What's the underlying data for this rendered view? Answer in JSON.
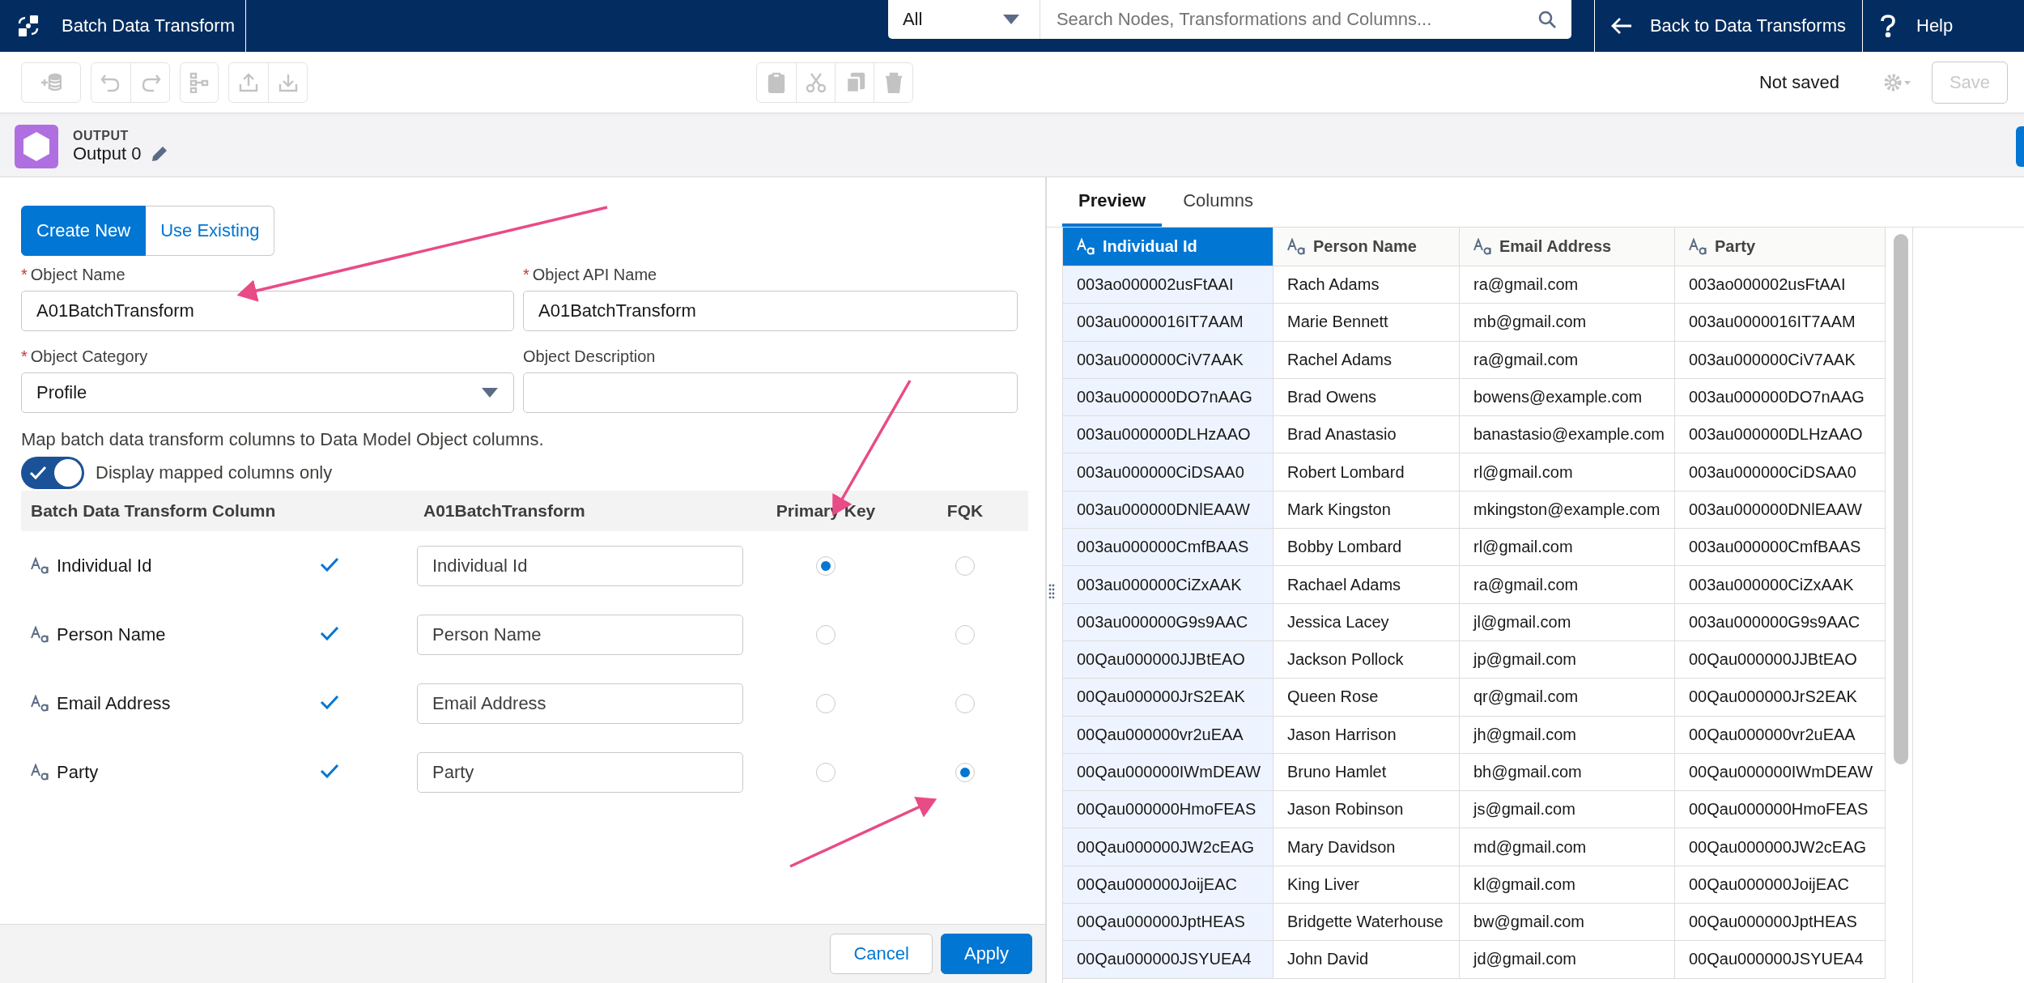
{
  "app_bar": {
    "title": "Batch Data Transform",
    "search_scope": "All",
    "search": {
      "placeholder": "Search Nodes, Transformations and Columns..."
    },
    "back_button": "Back to Data Transforms",
    "help_button": "Help"
  },
  "toolbar": {
    "status": "Not saved",
    "save_button": "Save"
  },
  "node": {
    "type_label": "OUTPUT",
    "name": "Output 0"
  },
  "form": {
    "mode_tabs": [
      {
        "label": "Create New",
        "selected": true
      },
      {
        "label": "Use Existing",
        "selected": false
      }
    ],
    "fields": [
      {
        "label": "Object Name",
        "required_mark": "*",
        "value": "A01BatchTransform",
        "kind": "text"
      },
      {
        "label": "Object API Name",
        "required_mark": "*",
        "value": "A01BatchTransform",
        "kind": "text"
      },
      {
        "label": "Object Category",
        "required_mark": "*",
        "value": "Profile",
        "kind": "select"
      },
      {
        "label": "Object Description",
        "kind": "text"
      }
    ],
    "map_hint": "Map batch data transform columns to Data Model Object columns.",
    "toggle": {
      "label": "Display mapped columns only",
      "on": true
    },
    "mapping_table": {
      "columns": [
        "Batch Data Transform Column",
        "A01BatchTransform",
        "Primary Key",
        "FQK"
      ],
      "rows": [
        {
          "source": "Individual Id",
          "mapped": true,
          "target": "Individual Id",
          "primary_key": true,
          "fqk": false
        },
        {
          "source": "Person Name",
          "mapped": true,
          "target": "Person Name",
          "primary_key": false,
          "fqk": false
        },
        {
          "source": "Email Address",
          "mapped": true,
          "target": "Email Address",
          "primary_key": false,
          "fqk": false
        },
        {
          "source": "Party",
          "mapped": true,
          "target": "Party",
          "primary_key": false,
          "fqk": true
        }
      ]
    },
    "buttons": {
      "cancel": "Cancel",
      "apply": "Apply"
    }
  },
  "preview": {
    "tabs": [
      {
        "label": "Preview",
        "selected": true
      },
      {
        "label": "Columns",
        "selected": false
      }
    ],
    "table": {
      "columns": [
        {
          "label": "Individual Id",
          "selected": true
        },
        {
          "label": "Person Name",
          "selected": false
        },
        {
          "label": "Email Address",
          "selected": false
        },
        {
          "label": "Party",
          "selected": false
        }
      ],
      "rows": [
        [
          "003ao000002usFtAAI",
          "Rach Adams",
          "ra@gmail.com",
          "003ao000002usFtAAI"
        ],
        [
          "003au0000016IT7AAM",
          "Marie Bennett",
          "mb@gmail.com",
          "003au0000016IT7AAM"
        ],
        [
          "003au000000CiV7AAK",
          "Rachel Adams",
          "ra@gmail.com",
          "003au000000CiV7AAK"
        ],
        [
          "003au000000DO7nAAG",
          "Brad Owens",
          "bowens@example.com",
          "003au000000DO7nAAG"
        ],
        [
          "003au000000DLHzAAO",
          "Brad Anastasio",
          "banastasio@example.com",
          "003au000000DLHzAAO"
        ],
        [
          "003au000000CiDSAA0",
          "Robert Lombard",
          "rl@gmail.com",
          "003au000000CiDSAA0"
        ],
        [
          "003au000000DNlEAAW",
          "Mark Kingston",
          "mkingston@example.com",
          "003au000000DNlEAAW"
        ],
        [
          "003au000000CmfBAAS",
          "Bobby Lombard",
          "rl@gmail.com",
          "003au000000CmfBAAS"
        ],
        [
          "003au000000CiZxAAK",
          "Rachael Adams",
          "ra@gmail.com",
          "003au000000CiZxAAK"
        ],
        [
          "003au000000G9s9AAC",
          "Jessica Lacey",
          "jl@gmail.com",
          "003au000000G9s9AAC"
        ],
        [
          "00Qau000000JJBtEAO",
          "Jackson Pollock",
          "jp@gmail.com",
          "00Qau000000JJBtEAO"
        ],
        [
          "00Qau000000JrS2EAK",
          "Queen Rose",
          "qr@gmail.com",
          "00Qau000000JrS2EAK"
        ],
        [
          "00Qau000000vr2uEAA",
          "Jason Harrison",
          "jh@gmail.com",
          "00Qau000000vr2uEAA"
        ],
        [
          "00Qau000000IWmDEAW",
          "Bruno Hamlet",
          "bh@gmail.com",
          "00Qau000000IWmDEAW"
        ],
        [
          "00Qau000000HmoFEAS",
          "Jason Robinson",
          "js@gmail.com",
          "00Qau000000HmoFEAS"
        ],
        [
          "00Qau000000JW2cEAG",
          "Mary Davidson",
          "md@gmail.com",
          "00Qau000000JW2cEAG"
        ],
        [
          "00Qau000000JoijEAC",
          "King Liver",
          "kl@gmail.com",
          "00Qau000000JoijEAC"
        ],
        [
          "00Qau000000JptHEAS",
          "Bridgette Waterhouse",
          "bw@gmail.com",
          "00Qau000000JptHEAS"
        ],
        [
          "00Qau000000JSYUEA4",
          "John David",
          "jd@gmail.com",
          "00Qau000000JSYUEA4"
        ]
      ]
    }
  }
}
